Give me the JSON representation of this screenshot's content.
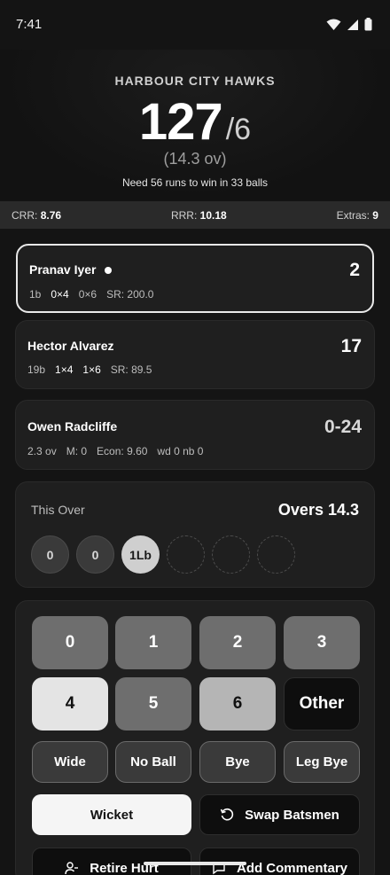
{
  "status": {
    "time": "7:41"
  },
  "header": {
    "team": "HARBOUR CITY HAWKS",
    "runs": "127",
    "wickets": "/6",
    "overs": "(14.3 ov)",
    "need": "Need 56 runs to win in 33 balls"
  },
  "stats": {
    "crr_label": "CRR:",
    "crr": "8.76",
    "rrr_label": "RRR:",
    "rrr": "10.18",
    "extras_label": "Extras:",
    "extras": "9"
  },
  "striker": {
    "name": "Pranav Iyer",
    "score": "2",
    "balls": "1b",
    "fours": "0×4",
    "sixes": "0×6",
    "sr": "SR: 200.0"
  },
  "non_striker": {
    "name": "Hector Alvarez",
    "score": "17",
    "balls": "19b",
    "fours": "1×4",
    "sixes": "1×6",
    "sr": "SR: 89.5"
  },
  "bowler": {
    "name": "Owen Radcliffe",
    "figures": "0-24",
    "overs": "2.3 ov",
    "maidens": "M: 0",
    "econ": "Econ: 9.60",
    "extras": "wd 0 nb 0"
  },
  "this_over": {
    "title": "This Over",
    "overs": "Overs 14.3",
    "balls": [
      "0",
      "0",
      "1Lb"
    ]
  },
  "keypad": {
    "runs": [
      "0",
      "1",
      "2",
      "3",
      "4",
      "5",
      "6"
    ],
    "other": "Other",
    "wide": "Wide",
    "no_ball": "No Ball",
    "bye": "Bye",
    "leg_bye": "Leg Bye",
    "wicket": "Wicket",
    "swap": "Swap Batsmen",
    "retire": "Retire Hurt",
    "commentary": "Add Commentary"
  }
}
